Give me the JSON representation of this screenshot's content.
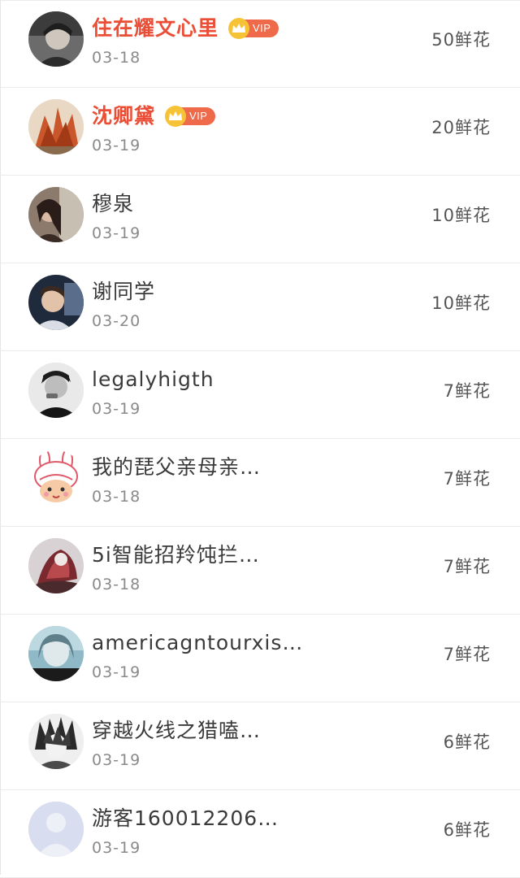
{
  "badge": {
    "vip_label": "VIP"
  },
  "colors": {
    "vip_name": "#ea4e36",
    "vip_badge": "#ee6a4a",
    "crown": "#f6c336",
    "name": "#3a3a3a",
    "date": "#8a8a8a",
    "amount": "#555555",
    "divider": "#ebebeb"
  },
  "rows": [
    {
      "name": "住在耀文心里",
      "date": "03-18",
      "amount": "50鲜花",
      "vip": true,
      "avatar_icon": "user-photo-avatar"
    },
    {
      "name": "沈卿黛",
      "date": "03-19",
      "amount": "20鲜花",
      "vip": true,
      "avatar_icon": "user-photo-avatar"
    },
    {
      "name": "穆泉",
      "date": "03-19",
      "amount": "10鲜花",
      "vip": false,
      "avatar_icon": "user-photo-avatar"
    },
    {
      "name": "谢同学",
      "date": "03-20",
      "amount": "10鲜花",
      "vip": false,
      "avatar_icon": "user-photo-avatar"
    },
    {
      "name": "legalyhigth",
      "date": "03-19",
      "amount": "7鲜花",
      "vip": false,
      "avatar_icon": "user-photo-avatar"
    },
    {
      "name": "我的琵父亲母亲…",
      "date": "03-18",
      "amount": "7鲜花",
      "vip": false,
      "avatar_icon": "cartoon-bunny-avatar"
    },
    {
      "name": "5i智能招羚饨拦…",
      "date": "03-18",
      "amount": "7鲜花",
      "vip": false,
      "avatar_icon": "user-photo-avatar"
    },
    {
      "name": "americagntourxis…",
      "date": "03-19",
      "amount": "7鲜花",
      "vip": false,
      "avatar_icon": "user-photo-avatar"
    },
    {
      "name": "穿越火线之猎嗑…",
      "date": "03-19",
      "amount": "6鲜花",
      "vip": false,
      "avatar_icon": "user-photo-avatar"
    },
    {
      "name": "游客160012206…",
      "date": "03-19",
      "amount": "6鲜花",
      "vip": false,
      "avatar_icon": "default-user-avatar"
    }
  ]
}
